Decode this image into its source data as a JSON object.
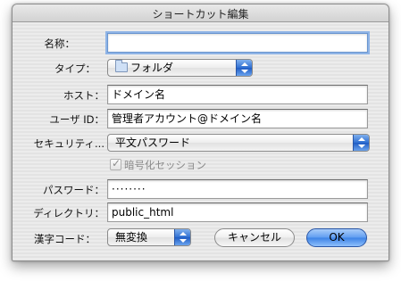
{
  "dialog": {
    "title": "ショートカット編集"
  },
  "fields": {
    "name": {
      "label": "名称：",
      "value": ""
    },
    "type": {
      "label": "タイプ：",
      "value": "フォルダ"
    },
    "host": {
      "label": "ホスト：",
      "value": "ドメイン名"
    },
    "user": {
      "label": "ユーザ ID：",
      "value": "管理者アカウント@ドメイン名"
    },
    "security": {
      "label": "セキュリティ...",
      "value": "平文パスワード"
    },
    "keychain": {
      "label": "暗号化セッション",
      "checked": true,
      "enabled": false
    },
    "password": {
      "label": "パスワード：",
      "value": "········"
    },
    "directory": {
      "label": "ディレクトリ：",
      "value": "public_html"
    },
    "encoding": {
      "label": "漢字コード：",
      "value": "無変換"
    }
  },
  "buttons": {
    "cancel": "キャンセル",
    "ok": "OK"
  },
  "colors": {
    "accent": "#3c82e6",
    "focus_ring": "#8fb4e6"
  }
}
